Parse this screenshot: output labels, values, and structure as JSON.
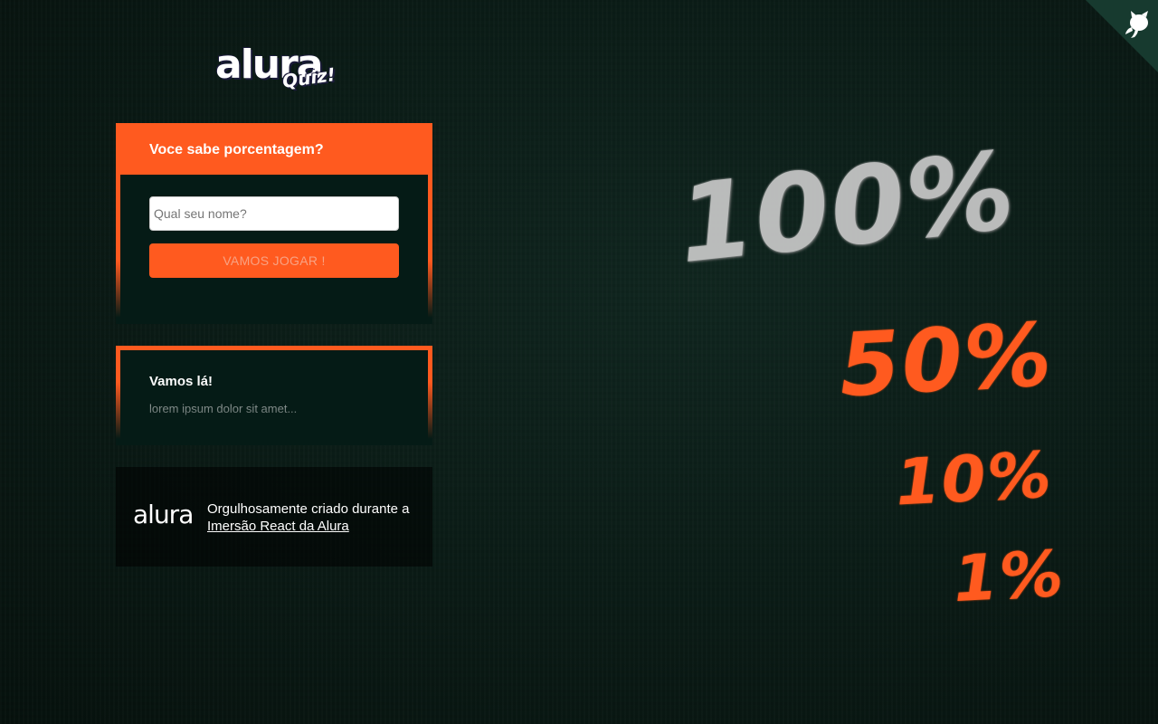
{
  "logo": {
    "brand": "alura",
    "sub": "Quiz!"
  },
  "quiz_card": {
    "title": "Voce sabe porcentagem?",
    "name_placeholder": "Qual seu nome?",
    "play_button": "VAMOS JOGAR !"
  },
  "info_card": {
    "title": "Vamos lá!",
    "text": "lorem ipsum dolor sit amet..."
  },
  "footer": {
    "logo": "alura",
    "text_prefix": "Orgulhosamente criado durante a",
    "link_text": "Imersão React da Alura"
  },
  "background_chalk": {
    "values": [
      "100%",
      "50%",
      "10%",
      "1%"
    ]
  },
  "corner": {
    "icon": "github-octocat-icon"
  },
  "colors": {
    "primary": "#ff5a1f",
    "background": "#0a1a15",
    "card_background": "#051b16",
    "chalk_white": "#c9c9c9"
  }
}
